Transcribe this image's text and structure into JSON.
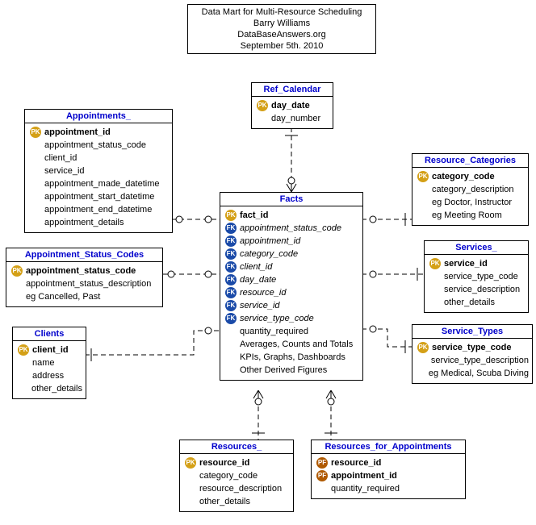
{
  "title": {
    "line1": "Data Mart for Multi-Resource Scheduling",
    "line2": "Barry Williams",
    "line3": "DataBaseAnswers.org",
    "line4": "September 5th. 2010"
  },
  "entities": {
    "ref_calendar": {
      "name": "Ref_Calendar",
      "fields": [
        {
          "key": "PK",
          "label": "day_date",
          "bold": true
        },
        {
          "key": "",
          "label": "day_number"
        }
      ]
    },
    "appointments": {
      "name": "Appointments_",
      "fields": [
        {
          "key": "PK",
          "label": "appointment_id",
          "bold": true
        },
        {
          "key": "",
          "label": "appointment_status_code"
        },
        {
          "key": "",
          "label": "client_id"
        },
        {
          "key": "",
          "label": "service_id"
        },
        {
          "key": "",
          "label": "appointment_made_datetime"
        },
        {
          "key": "",
          "label": "appointment_start_datetime"
        },
        {
          "key": "",
          "label": "appointment_end_datetime"
        },
        {
          "key": "",
          "label": "appointment_details"
        }
      ]
    },
    "apt_status": {
      "name": "Appointment_Status_Codes",
      "fields": [
        {
          "key": "PK",
          "label": "appointment_status_code",
          "bold": true
        },
        {
          "key": "",
          "label": "appointment_status_description"
        },
        {
          "key": "",
          "label": "eg Cancelled, Past"
        }
      ]
    },
    "clients": {
      "name": "Clients",
      "fields": [
        {
          "key": "PK",
          "label": "client_id",
          "bold": true
        },
        {
          "key": "",
          "label": "name"
        },
        {
          "key": "",
          "label": "address"
        },
        {
          "key": "",
          "label": "other_details"
        }
      ]
    },
    "facts": {
      "name": "Facts",
      "fields": [
        {
          "key": "PK",
          "label": "fact_id",
          "bold": true
        },
        {
          "key": "FK",
          "label": "appointment_status_code",
          "italic": true
        },
        {
          "key": "FK",
          "label": "appointment_id",
          "italic": true
        },
        {
          "key": "FK",
          "label": "category_code",
          "italic": true
        },
        {
          "key": "FK",
          "label": "client_id",
          "italic": true
        },
        {
          "key": "FK",
          "label": "day_date",
          "italic": true
        },
        {
          "key": "FK",
          "label": "resource_id",
          "italic": true
        },
        {
          "key": "FK",
          "label": "service_id",
          "italic": true
        },
        {
          "key": "FK",
          "label": "service_type_code",
          "italic": true
        },
        {
          "key": "",
          "label": "quantity_required"
        },
        {
          "key": "",
          "label": "Averages, Counts and Totals"
        },
        {
          "key": "",
          "label": "KPIs, Graphs, Dashboards"
        },
        {
          "key": "",
          "label": "Other Derived Figures"
        }
      ]
    },
    "res_cat": {
      "name": "Resource_Categories",
      "fields": [
        {
          "key": "PK",
          "label": "category_code",
          "bold": true
        },
        {
          "key": "",
          "label": "category_description"
        },
        {
          "key": "",
          "label": "eg Doctor, Instructor"
        },
        {
          "key": "",
          "label": "eg Meeting Room"
        }
      ]
    },
    "services": {
      "name": "Services_",
      "fields": [
        {
          "key": "PK",
          "label": "service_id",
          "bold": true
        },
        {
          "key": "",
          "label": "service_type_code"
        },
        {
          "key": "",
          "label": "service_description"
        },
        {
          "key": "",
          "label": "other_details"
        }
      ]
    },
    "svc_types": {
      "name": "Service_Types",
      "fields": [
        {
          "key": "PK",
          "label": "service_type_code",
          "bold": true
        },
        {
          "key": "",
          "label": "service_type_description"
        },
        {
          "key": "",
          "label": "eg Medical, Scuba Diving"
        }
      ]
    },
    "resources": {
      "name": "Resources_",
      "fields": [
        {
          "key": "PK",
          "label": "resource_id",
          "bold": true
        },
        {
          "key": "",
          "label": "category_code"
        },
        {
          "key": "",
          "label": "resource_description"
        },
        {
          "key": "",
          "label": "other_details"
        }
      ]
    },
    "res_for_apt": {
      "name": "Resources_for_Appointments",
      "fields": [
        {
          "key": "PF",
          "label": "resource_id",
          "bold": true
        },
        {
          "key": "PF",
          "label": "appointment_id",
          "bold": true
        },
        {
          "key": "",
          "label": "quantity_required"
        }
      ]
    }
  }
}
